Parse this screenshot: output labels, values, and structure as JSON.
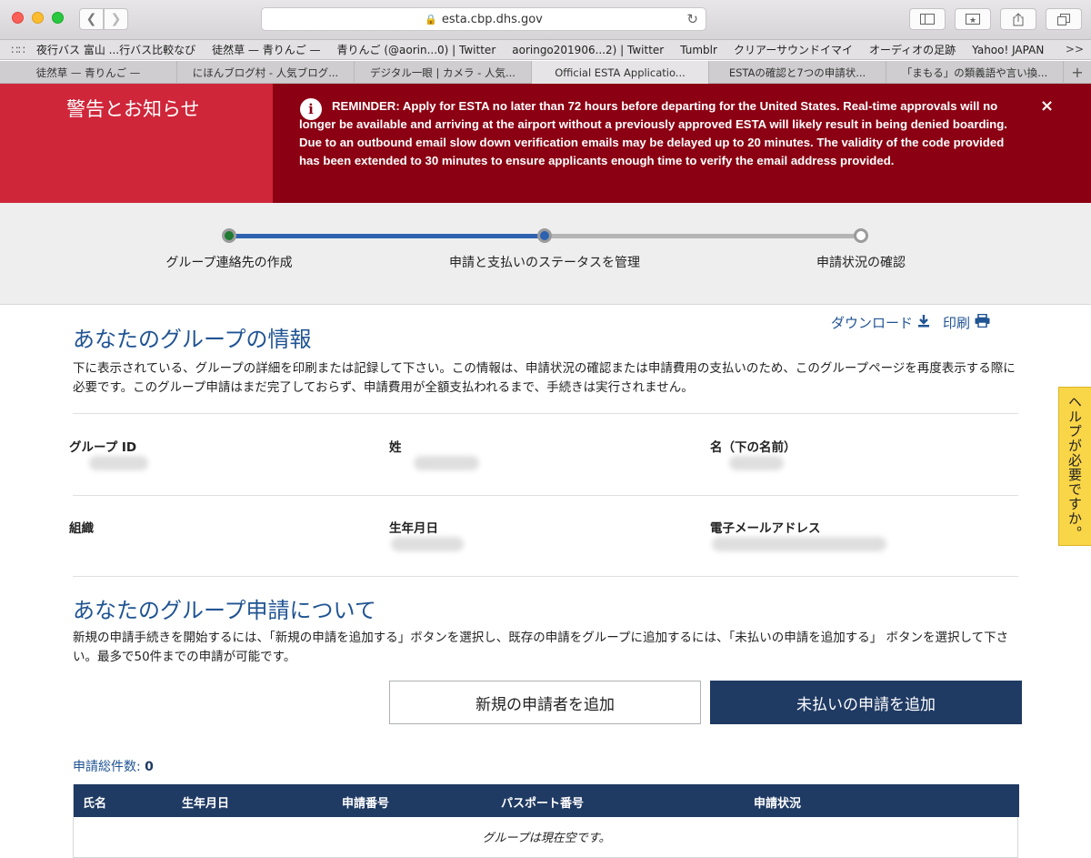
{
  "browser": {
    "url": "esta.cbp.dhs.gov",
    "bookmarks": [
      "夜行バス 富山 ...行バス比較なび",
      "徒然草 — 青りんご —",
      "青りんご (@aorin...0) | Twitter",
      "aoringo201906...2) | Twitter",
      "Tumblr",
      "クリアーサウンドイマイ",
      "オーディオの足跡",
      "Yahoo! JAPAN"
    ],
    "bookmarks_more": ">>",
    "tabs": [
      "徒然草 — 青りんご —",
      "にほんブログ村 - 人気ブログ...",
      "デジタル一眼 | カメラ - 人気...",
      "Official ESTA Applicatio...",
      "ESTAの確認と7つの申請状...",
      "「まもる」の類義語や言い換..."
    ],
    "active_tab": 3,
    "new_tab": "+"
  },
  "alert": {
    "title": "警告とお知らせ",
    "message": "REMINDER: Apply for ESTA no later than 72 hours before departing for the United States. Real-time approvals will no longer be available and arriving at the airport without a previously approved ESTA will likely result in being denied boarding. Due to an outbound email slow down verification emails may be delayed up to 20 minutes. The validity of the code provided has been extended to 30 minutes to ensure applicants enough time to verify the email address provided.",
    "close": "×",
    "info_icon": "i"
  },
  "stepper": {
    "steps": [
      "グループ連絡先の作成",
      "申請と支払いのステータスを管理",
      "申請状況の確認"
    ],
    "current_step": 2
  },
  "group_info": {
    "title": "あなたのグループの情報",
    "download_label": "ダウンロード",
    "print_label": "印刷",
    "description": "下に表示されている、グループの詳細を印刷または記録して下さい。この情報は、申請状況の確認または申請費用の支払いのため、このグループページを再度表示する際に必要です。このグループ申請はまだ完了しておらず、申請費用が全額支払われるまで、手続きは実行されません。",
    "fields": {
      "group_id": "グループ ID",
      "last_name": "姓",
      "first_name": "名（下の名前）",
      "organization": "組織",
      "birth_date": "生年月日",
      "email": "電子メールアドレス"
    }
  },
  "applications": {
    "title": "あなたのグループ申請について",
    "description": "新規の申請手続きを開始するには、「新規の申請を追加する」ボタンを選択し、既存の申請をグループに追加するには、「未払いの申請を追加する」 ボタンを選択して下さい。最多で50件までの申請が可能です。",
    "add_new_button": "新規の申請者を追加",
    "add_unpaid_button": "未払いの申請を追加",
    "count_label": "申請総件数:",
    "count_value": "0",
    "columns": [
      "氏名",
      "生年月日",
      "申請番号",
      "パスポート番号",
      "申請状況"
    ],
    "empty_message": "グループは現在空です。"
  },
  "help_tab": "ヘルプが必要ですか。"
}
